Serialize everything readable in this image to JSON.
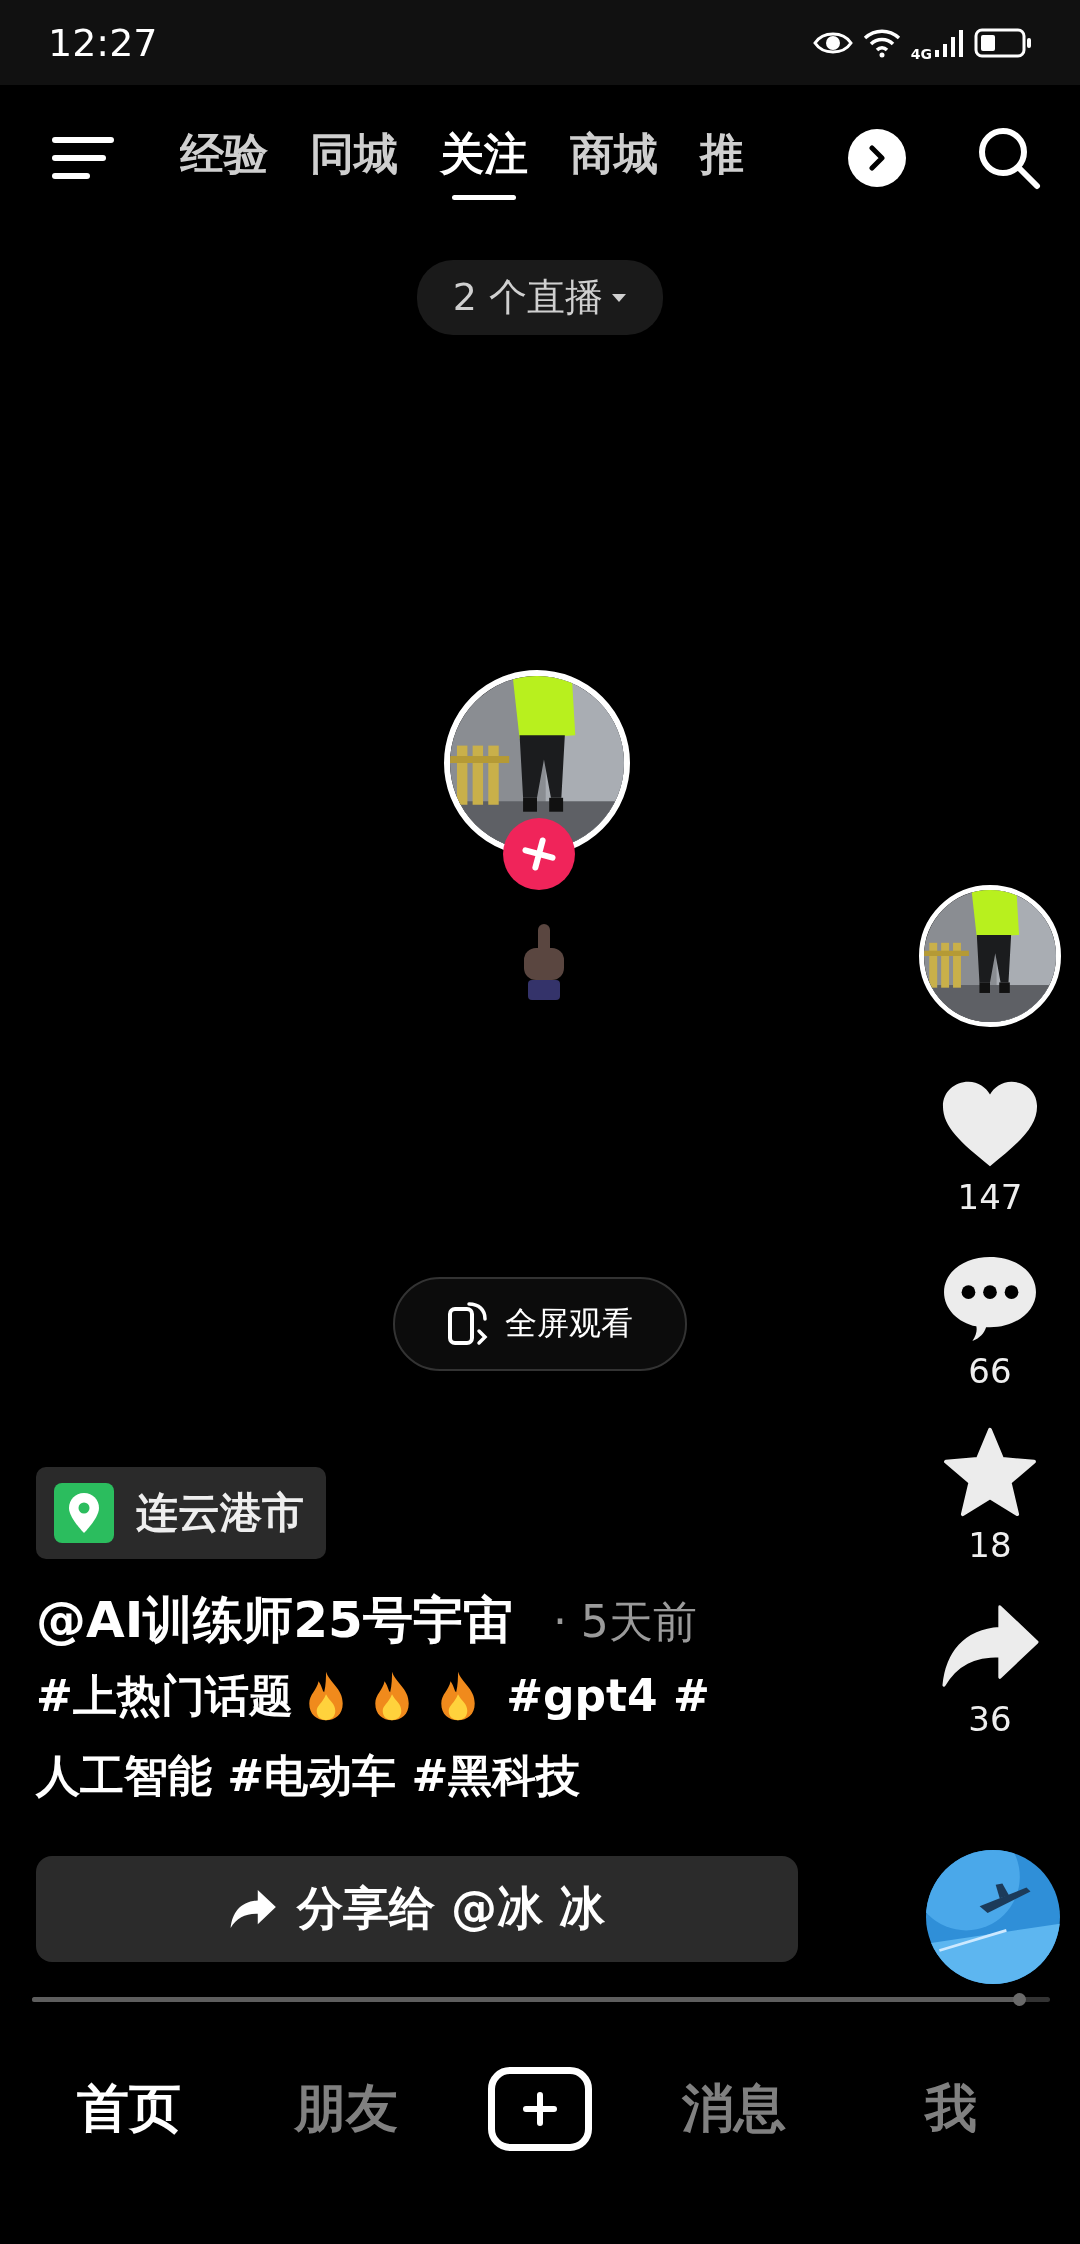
{
  "status_bar": {
    "time": "12:27",
    "network": "4G"
  },
  "tabs": [
    {
      "label": "经验",
      "selected": false
    },
    {
      "label": "同城",
      "selected": false
    },
    {
      "label": "关注",
      "selected": true
    },
    {
      "label": "商城",
      "selected": false
    },
    {
      "label": "推",
      "selected": false
    }
  ],
  "live_pill": {
    "label": "2 个直播"
  },
  "fullscreen_button": {
    "label": "全屏观看"
  },
  "actions": [
    {
      "kind": "like",
      "count": "147"
    },
    {
      "kind": "comment",
      "count": "66"
    },
    {
      "kind": "favorite",
      "count": "18"
    },
    {
      "kind": "share",
      "count": "36"
    }
  ],
  "location": {
    "label": "连云港市"
  },
  "author": {
    "name": "@AI训练师25号宇宙",
    "time": "· 5天前"
  },
  "caption_lines": [
    [
      {
        "kind": "text",
        "text": "#上热门话题"
      },
      {
        "kind": "fire"
      },
      {
        "kind": "fire"
      },
      {
        "kind": "fire"
      },
      {
        "kind": "text",
        "text": " #gpt4 #"
      }
    ],
    [
      {
        "kind": "text",
        "text": "人工智能 #电动车 #黑科技"
      }
    ]
  ],
  "share_button": {
    "label": "分享给 @冰 冰"
  },
  "progress": {
    "level": 0.97
  },
  "bottom_nav": [
    {
      "kind": "text",
      "label": "首页",
      "selected": true
    },
    {
      "kind": "text",
      "label": "朋友",
      "selected": false
    },
    {
      "kind": "create",
      "selected": false
    },
    {
      "kind": "text",
      "label": "消息",
      "selected": false
    },
    {
      "kind": "text",
      "label": "我",
      "selected": false
    }
  ]
}
